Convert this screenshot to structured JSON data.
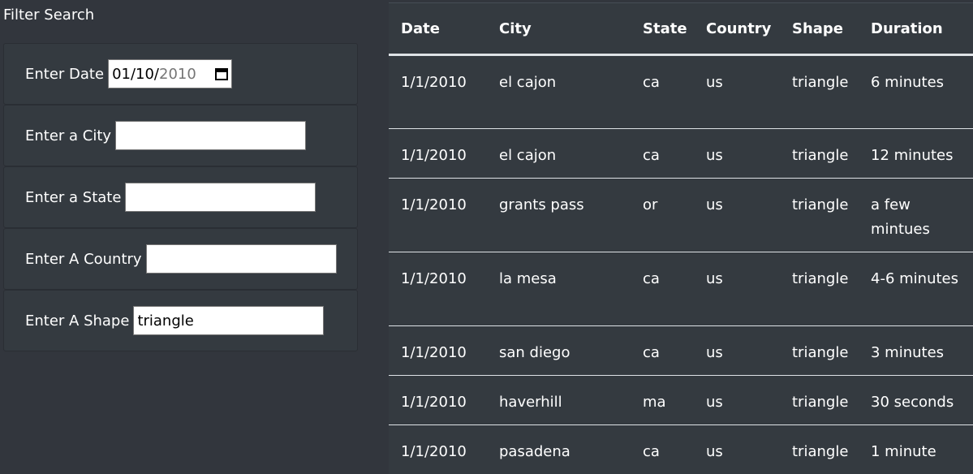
{
  "filter": {
    "title": "Filter Search",
    "date": {
      "label": "Enter Date",
      "value_mdy": "01/10/",
      "value_year": "2010"
    },
    "city": {
      "label": "Enter a City",
      "value": ""
    },
    "state": {
      "label": "Enter a State",
      "value": ""
    },
    "country": {
      "label": "Enter A Country",
      "value": ""
    },
    "shape": {
      "label": "Enter A Shape",
      "value": "triangle"
    }
  },
  "table": {
    "headers": [
      "Date",
      "City",
      "State",
      "Country",
      "Shape",
      "Duration"
    ],
    "rows": [
      [
        "1/1/2010",
        "el cajon",
        "ca",
        "us",
        "triangle",
        "6 minutes"
      ],
      [
        "1/1/2010",
        "el cajon",
        "ca",
        "us",
        "triangle",
        "12 minutes"
      ],
      [
        "1/1/2010",
        "grants pass",
        "or",
        "us",
        "triangle",
        "a few mintues"
      ],
      [
        "1/1/2010",
        "la mesa",
        "ca",
        "us",
        "triangle",
        "4-6 minutes"
      ],
      [
        "1/1/2010",
        "san diego",
        "ca",
        "us",
        "triangle",
        "3 minutes"
      ],
      [
        "1/1/2010",
        "haverhill",
        "ma",
        "us",
        "triangle",
        "30 seconds"
      ],
      [
        "1/1/2010",
        "pasadena",
        "ca",
        "us",
        "triangle",
        "1 minute"
      ]
    ]
  }
}
